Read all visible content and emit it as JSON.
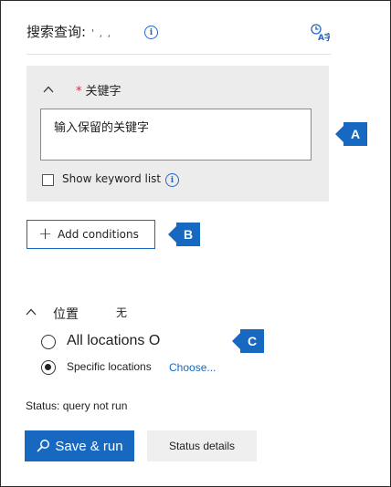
{
  "header": {
    "title": "搜索查询:",
    "title_tail": "' , ,",
    "info_icon": "info-icon",
    "translate_icon": "translate-icon"
  },
  "keywords_panel": {
    "required_mark": "*",
    "label": "关键字",
    "input_placeholder": "输入保留的关键字",
    "show_list_label": "Show keyword list",
    "show_list_checked": false
  },
  "conditions": {
    "add_label": "Add conditions"
  },
  "locations": {
    "label": "位置",
    "value": "无",
    "options": [
      {
        "label": "All locations O",
        "selected": false
      },
      {
        "label": "Specific locations",
        "selected": true
      }
    ],
    "choose_link": "Choose..."
  },
  "status": {
    "text": "Status: query not run"
  },
  "actions": {
    "save_run": "Save & run",
    "status_details": "Status details"
  },
  "callouts": [
    "A",
    "B",
    "C"
  ],
  "colors": {
    "accent": "#1668c0",
    "panel_bg": "#ececec",
    "required": "#c4314b",
    "secondary_button": "#efefef"
  }
}
